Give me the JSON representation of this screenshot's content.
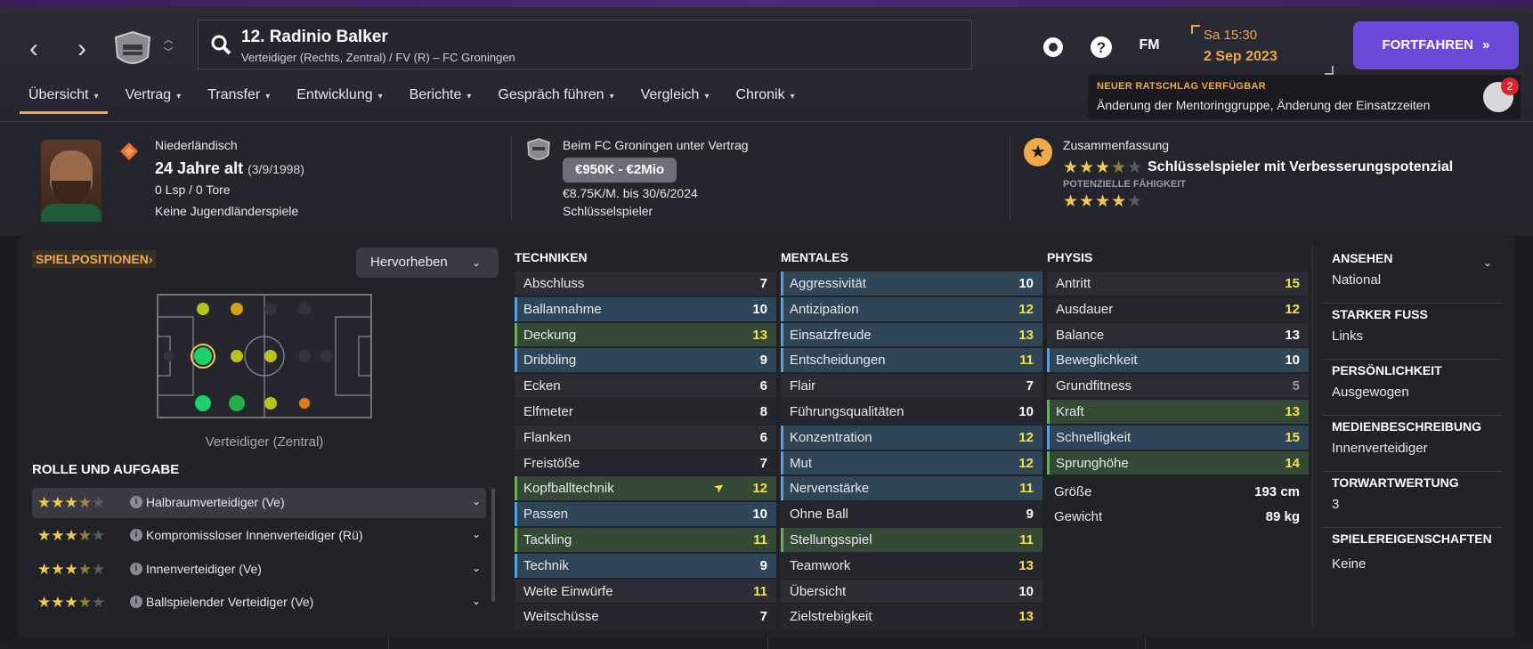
{
  "header": {
    "player_title": "12. Radinio Balker",
    "player_subtitle": "Verteidiger (Rechts, Zentral) / FV (R) – FC Groningen",
    "fm_label": "FM",
    "day_time": "Sa 15:30",
    "date": "2 Sep 2023",
    "continue_label": "FORTFAHREN",
    "advice_title": "NEUER RATSCHLAG VERFÜGBAR",
    "advice_text": "Änderung der Mentoringgruppe, Änderung der Einsatzzeiten",
    "advice_count": "2"
  },
  "tabs": [
    {
      "label": "Übersicht"
    },
    {
      "label": "Vertrag"
    },
    {
      "label": "Transfer"
    },
    {
      "label": "Entwicklung"
    },
    {
      "label": "Berichte"
    },
    {
      "label": "Gespräch führen"
    },
    {
      "label": "Vergleich"
    },
    {
      "label": "Chronik"
    }
  ],
  "info": {
    "nationality": "Niederländisch",
    "age": "24 Jahre alt",
    "birthdate": "(3/9/1998)",
    "caps": "0 Lsp / 0 Tore",
    "youth_caps": "Keine Jugendländerspiele",
    "contract_title": "Beim FC Groningen unter Vertrag",
    "value": "€950K - €2Mio",
    "wage": "€8.75K/M. bis 30/6/2024",
    "squad_role": "Schlüsselspieler",
    "summary_title": "Zusammenfassung",
    "current_ability_stars": 3.5,
    "summary_desc": "Schlüsselspieler mit Verbesserungspotenzial",
    "potential_label": "POTENZIELLE FÄHIGKEIT",
    "potential_stars": 4
  },
  "positions": {
    "title": "SPIELPOSITIONEN",
    "highlight_label": "Hervorheben",
    "position_label": "Verteidiger (Zentral)"
  },
  "roles": {
    "title": "ROLLE UND AUFGABE",
    "items": [
      {
        "name": "Halbraumverteidiger (Ve)",
        "stars": 3.5
      },
      {
        "name": "Kompromissloser Innenverteidiger (Rü)",
        "stars": 3.5
      },
      {
        "name": "Innenverteidiger (Ve)",
        "stars": 3.5
      },
      {
        "name": "Ballspielender Verteidiger (Ve)",
        "stars": 3.5
      }
    ]
  },
  "technical": {
    "title": "TECHNIKEN",
    "rows": [
      {
        "name": "Abschluss",
        "value": "7",
        "hl": "",
        "c": "w"
      },
      {
        "name": "Ballannahme",
        "value": "10",
        "hl": "b",
        "c": "w"
      },
      {
        "name": "Deckung",
        "value": "13",
        "hl": "g",
        "c": "y"
      },
      {
        "name": "Dribbling",
        "value": "9",
        "hl": "b",
        "c": "w"
      },
      {
        "name": "Ecken",
        "value": "6",
        "hl": "",
        "c": "w"
      },
      {
        "name": "Elfmeter",
        "value": "8",
        "hl": "",
        "c": "w"
      },
      {
        "name": "Flanken",
        "value": "6",
        "hl": "",
        "c": "w"
      },
      {
        "name": "Freistöße",
        "value": "7",
        "hl": "",
        "c": "w"
      },
      {
        "name": "Kopfballtechnik",
        "value": "12",
        "hl": "g",
        "c": "y"
      },
      {
        "name": "Passen",
        "value": "10",
        "hl": "b",
        "c": "w"
      },
      {
        "name": "Tackling",
        "value": "11",
        "hl": "g",
        "c": "y"
      },
      {
        "name": "Technik",
        "value": "9",
        "hl": "b",
        "c": "w"
      },
      {
        "name": "Weite Einwürfe",
        "value": "11",
        "hl": "",
        "c": "y"
      },
      {
        "name": "Weitschüsse",
        "value": "7",
        "hl": "",
        "c": "w"
      }
    ]
  },
  "mental": {
    "title": "MENTALES",
    "rows": [
      {
        "name": "Aggressivität",
        "value": "10",
        "hl": "b",
        "c": "w"
      },
      {
        "name": "Antizipation",
        "value": "12",
        "hl": "b",
        "c": "y"
      },
      {
        "name": "Einsatzfreude",
        "value": "13",
        "hl": "b",
        "c": "y"
      },
      {
        "name": "Entscheidungen",
        "value": "11",
        "hl": "b",
        "c": "y"
      },
      {
        "name": "Flair",
        "value": "7",
        "hl": "",
        "c": "w"
      },
      {
        "name": "Führungsqualitäten",
        "value": "10",
        "hl": "",
        "c": "w"
      },
      {
        "name": "Konzentration",
        "value": "12",
        "hl": "b",
        "c": "y"
      },
      {
        "name": "Mut",
        "value": "12",
        "hl": "b",
        "c": "y"
      },
      {
        "name": "Nervenstärke",
        "value": "11",
        "hl": "b",
        "c": "y"
      },
      {
        "name": "Ohne Ball",
        "value": "9",
        "hl": "",
        "c": "w"
      },
      {
        "name": "Stellungsspiel",
        "value": "11",
        "hl": "g",
        "c": "y"
      },
      {
        "name": "Teamwork",
        "value": "13",
        "hl": "",
        "c": "y"
      },
      {
        "name": "Übersicht",
        "value": "10",
        "hl": "",
        "c": "w"
      },
      {
        "name": "Zielstrebigkeit",
        "value": "13",
        "hl": "",
        "c": "y"
      }
    ]
  },
  "physical": {
    "title": "PHYSIS",
    "rows": [
      {
        "name": "Antritt",
        "value": "15",
        "hl": "",
        "c": "y"
      },
      {
        "name": "Ausdauer",
        "value": "12",
        "hl": "",
        "c": "y"
      },
      {
        "name": "Balance",
        "value": "13",
        "hl": "",
        "c": "w"
      },
      {
        "name": "Beweglichkeit",
        "value": "10",
        "hl": "b",
        "c": "w"
      },
      {
        "name": "Grundfitness",
        "value": "5",
        "hl": "",
        "c": "g"
      },
      {
        "name": "Kraft",
        "value": "13",
        "hl": "g",
        "c": "y"
      },
      {
        "name": "Schnelligkeit",
        "value": "15",
        "hl": "b",
        "c": "y"
      },
      {
        "name": "Sprunghöhe",
        "value": "14",
        "hl": "g",
        "c": "y"
      }
    ],
    "height_label": "Größe",
    "height_value": "193 cm",
    "weight_label": "Gewicht",
    "weight_value": "89 kg"
  },
  "sidepanel": [
    {
      "h": "ANSEHEN",
      "v": "National"
    },
    {
      "h": "STARKER FUSS",
      "v": "Links"
    },
    {
      "h": "PERSÖNLICHKEIT",
      "v": "Ausgewogen"
    },
    {
      "h": "MEDIENBESCHREIBUNG",
      "v": "Innenverteidiger"
    },
    {
      "h": "TORWARTWERTUNG",
      "v": "3"
    },
    {
      "h": "SPIELEREIGENSCHAFTEN",
      "v": "Keine"
    }
  ],
  "colors": {
    "accent": "#f0a848",
    "button": "#6a48d8",
    "highlight_blue": "#2e4658",
    "highlight_green": "#354a36"
  }
}
